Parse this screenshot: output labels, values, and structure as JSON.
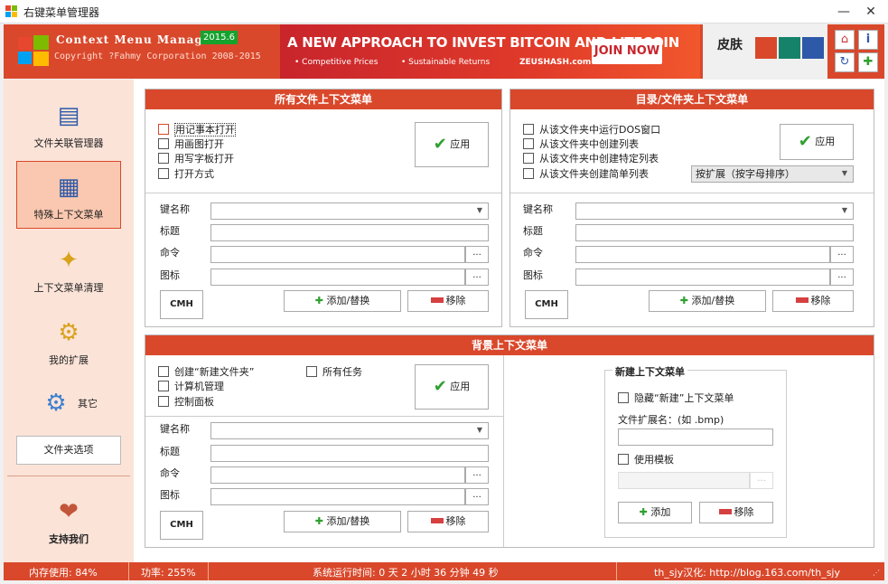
{
  "window": {
    "title": "右键菜单管理器"
  },
  "header": {
    "product_name": "Context Menu Manager",
    "version": "2015.6",
    "copyright": "Copyright ?Fahmy Corporation 2008-2015"
  },
  "ad": {
    "headline": "A NEW APPROACH TO INVEST BITCOIN AND LITECOIN",
    "feature1": "• Competitive Prices",
    "feature2": "• Sustainable Returns",
    "brand": "ZEUSHASH.com",
    "cta": "JOIN NOW"
  },
  "skin": {
    "label": "皮肤",
    "colors": [
      "#d9482b",
      "#16826a",
      "#2d59a8"
    ]
  },
  "sidebar": {
    "items": [
      {
        "label": "文件关联管理器"
      },
      {
        "label": "特殊上下文菜单"
      },
      {
        "label": "上下文菜单清理"
      },
      {
        "label": "我的扩展"
      },
      {
        "label": "其它"
      }
    ],
    "folder_options": "文件夹选项",
    "support": "支持我们"
  },
  "common": {
    "key_name": "键名称",
    "title": "标题",
    "command": "命令",
    "icon": "图标",
    "apply": "应用",
    "add_replace": "添加/替换",
    "remove": "移除",
    "cmh": "CMH",
    "browse": "..."
  },
  "all_files": {
    "title": "所有文件上下文菜单",
    "options": [
      "用记事本打开",
      "用画图打开",
      "用写字板打开",
      "打开方式"
    ]
  },
  "folders": {
    "title": "目录/文件夹上下文菜单",
    "options": [
      "从该文件夹中运行DOS窗口",
      "从该文件夹中创建列表",
      "从该文件夹中创建特定列表",
      "从该文件夹创建简单列表"
    ],
    "sort_value": "按扩展（按字母排序）"
  },
  "background": {
    "title": "背景上下文菜单",
    "options": [
      "创建“新建文件夹”",
      "计算机管理",
      "控制面板"
    ],
    "option_all_tasks": "所有任务"
  },
  "new_menu": {
    "group_title": "新建上下文菜单",
    "hide_label": "隐藏“新建”上下文菜单",
    "ext_label": "文件扩展名：(如 .bmp)",
    "use_template": "使用模板",
    "add": "添加",
    "remove": "移除"
  },
  "status": {
    "memory": "内存使用: 84%",
    "power": "功率: 255%",
    "uptime": "系统运行时间: 0 天 2 小时 36 分钟 49 秒",
    "credit": "th_sjy汉化: http://blog.163.com/th_sjy"
  }
}
